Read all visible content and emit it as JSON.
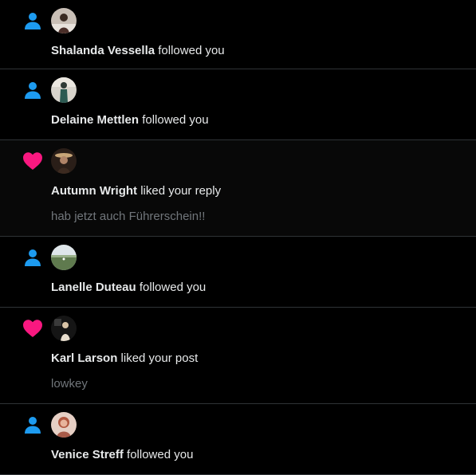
{
  "colors": {
    "background": "#000000",
    "divider": "#2f3336",
    "text_primary": "#e7e9ea",
    "text_secondary": "#71767b",
    "follow_icon": "#1d9bf0",
    "like_icon": "#f91880"
  },
  "notifications": [
    {
      "type": "follow",
      "icon": "person-icon",
      "user": "Shalanda Vessella",
      "action": " followed you",
      "preview": ""
    },
    {
      "type": "follow",
      "icon": "person-icon",
      "user": "Delaine Mettlen",
      "action": " followed you",
      "preview": ""
    },
    {
      "type": "like",
      "icon": "heart-icon",
      "user": "Autumn Wright",
      "action": " liked your reply",
      "preview": "hab jetzt auch Führerschein!!"
    },
    {
      "type": "follow",
      "icon": "person-icon",
      "user": "Lanelle Duteau",
      "action": " followed you",
      "preview": ""
    },
    {
      "type": "like",
      "icon": "heart-icon",
      "user": "Karl Larson",
      "action": " liked your post",
      "preview": "lowkey"
    },
    {
      "type": "follow",
      "icon": "person-icon",
      "user": "Venice Streff",
      "action": " followed you",
      "preview": ""
    }
  ]
}
